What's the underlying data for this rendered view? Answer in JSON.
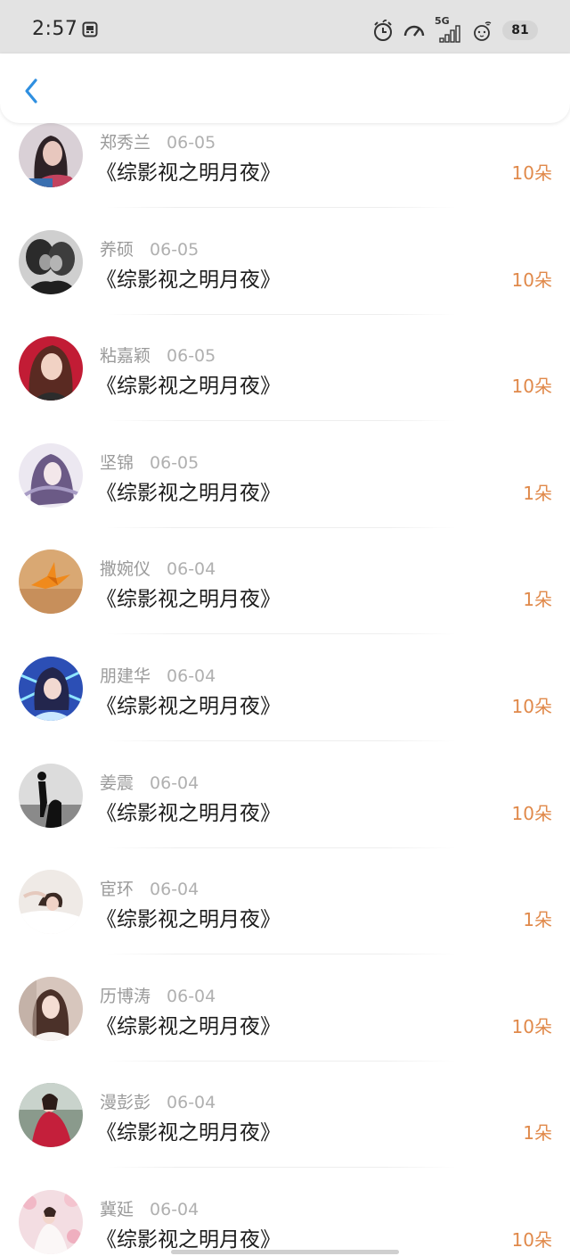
{
  "status_bar": {
    "time": "2:57",
    "network": "5G",
    "battery": "81"
  },
  "header": {
    "back_icon": "chevron-left-icon",
    "accent_color": "#2f8fe0"
  },
  "list": {
    "amount_color": "#e0894a",
    "items": [
      {
        "name": "郑秀兰",
        "date": "06-05",
        "title": "《综影视之明月夜》",
        "amount": "10朵",
        "avatar": "woman-portrait-avatar"
      },
      {
        "name": "养硕",
        "date": "06-05",
        "title": "《综影视之明月夜》",
        "amount": "10朵",
        "avatar": "couple-bw-avatar"
      },
      {
        "name": "粘嘉颖",
        "date": "06-05",
        "title": "《综影视之明月夜》",
        "amount": "10朵",
        "avatar": "anime-girl-avatar"
      },
      {
        "name": "坚锦",
        "date": "06-05",
        "title": "《综影视之明月夜》",
        "amount": "1朵",
        "avatar": "anime-purple-avatar"
      },
      {
        "name": "撒婉仪",
        "date": "06-04",
        "title": "《综影视之明月夜》",
        "amount": "1朵",
        "avatar": "paper-crane-avatar"
      },
      {
        "name": "朋建华",
        "date": "06-04",
        "title": "《综影视之明月夜》",
        "amount": "10朵",
        "avatar": "anime-blue-avatar"
      },
      {
        "name": "姜震",
        "date": "06-04",
        "title": "《综影视之明月夜》",
        "amount": "10朵",
        "avatar": "silhouette-avatar"
      },
      {
        "name": "宦环",
        "date": "06-04",
        "title": "《综影视之明月夜》",
        "amount": "1朵",
        "avatar": "woman-bed-avatar"
      },
      {
        "name": "历博涛",
        "date": "06-04",
        "title": "《综影视之明月夜》",
        "amount": "10朵",
        "avatar": "woman-hat-avatar"
      },
      {
        "name": "漫彭彭",
        "date": "06-04",
        "title": "《综影视之明月夜》",
        "amount": "1朵",
        "avatar": "red-dress-avatar"
      },
      {
        "name": "冀延",
        "date": "06-04",
        "title": "《综影视之明月夜》",
        "amount": "10朵",
        "avatar": "blossom-avatar"
      }
    ]
  }
}
